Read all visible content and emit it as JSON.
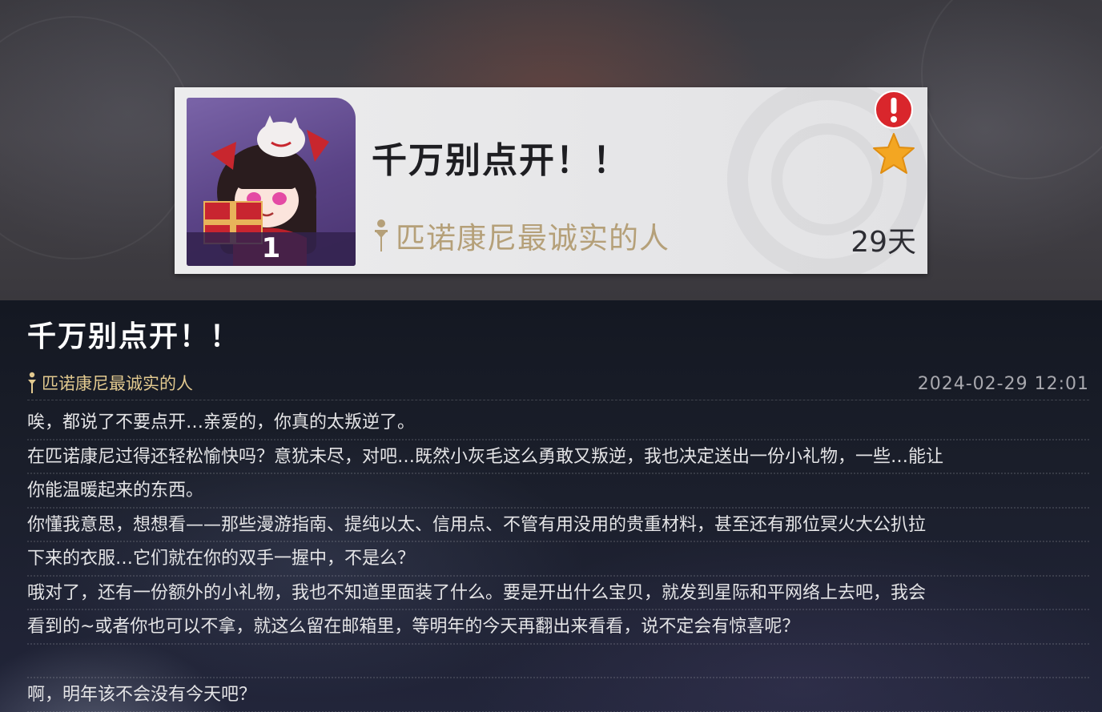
{
  "mail_card": {
    "title": "千万别点开！！",
    "sender": "匹诺康尼最诚实的人",
    "attachment_count": "1",
    "days_left": "29天",
    "badge": "!"
  },
  "letter": {
    "title": "千万别点开！！",
    "sender": "匹诺康尼最诚实的人",
    "timestamp": "2024-02-29 12:01",
    "lines": [
      "唉，都说了不要点开…亲爱的，你真的太叛逆了。",
      "在匹诺康尼过得还轻松愉快吗？意犹未尽，对吧…既然小灰毛这么勇敢又叛逆，我也决定送出一份小礼物，一些…能让",
      "你能温暖起来的东西。",
      "你懂我意思，想想看——那些漫游指南、提纯以太、信用点、不管有用没用的贵重材料，甚至还有那位冥火大公扒拉",
      "下来的衣服…它们就在你的双手一握中，不是么？",
      "哦对了，还有一份额外的小礼物，我也不知道里面装了什么。要是开出什么宝贝，就发到星际和平网络上去吧，我会",
      "看到的~或者你也可以不拿，就这么留在邮箱里，等明年的今天再翻出来看看，说不定会有惊喜呢？",
      "",
      "啊，明年该不会没有今天吧？"
    ]
  },
  "colors": {
    "sender_gold_card": "#b5a079",
    "sender_gold_letter": "#e2c98f",
    "badge_red": "#d9262c",
    "star_orange": "#f3a622"
  },
  "icons": {
    "sender": "quill-pin-icon",
    "badge": "exclamation-badge-icon",
    "star": "star-icon"
  }
}
